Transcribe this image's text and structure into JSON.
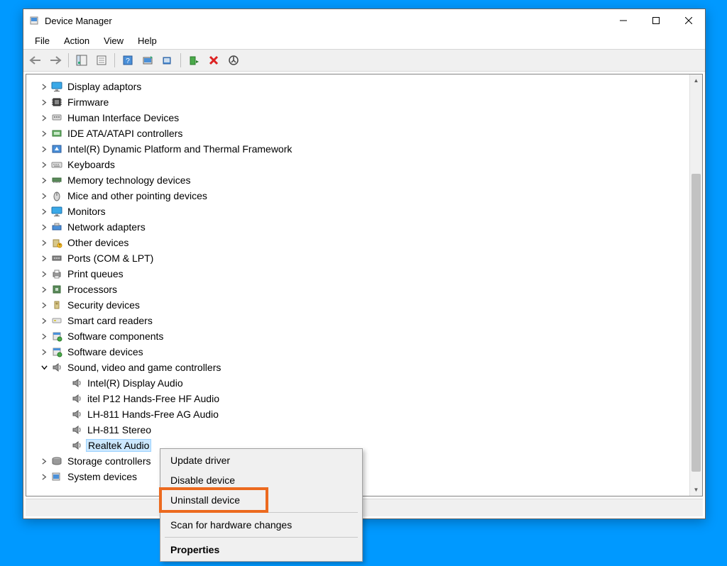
{
  "window": {
    "title": "Device Manager"
  },
  "menubar": {
    "file": "File",
    "action": "Action",
    "view": "View",
    "help": "Help"
  },
  "tree": {
    "items": [
      {
        "label": "Display adaptors",
        "icon": "monitor",
        "expanded": false,
        "level": 1
      },
      {
        "label": "Firmware",
        "icon": "chip",
        "expanded": false,
        "level": 1
      },
      {
        "label": "Human Interface Devices",
        "icon": "hid",
        "expanded": false,
        "level": 1
      },
      {
        "label": "IDE ATA/ATAPI controllers",
        "icon": "ide",
        "expanded": false,
        "level": 1
      },
      {
        "label": "Intel(R) Dynamic Platform and Thermal Framework",
        "icon": "thermal",
        "expanded": false,
        "level": 1
      },
      {
        "label": "Keyboards",
        "icon": "keyboard",
        "expanded": false,
        "level": 1
      },
      {
        "label": "Memory technology devices",
        "icon": "memory",
        "expanded": false,
        "level": 1
      },
      {
        "label": "Mice and other pointing devices",
        "icon": "mouse",
        "expanded": false,
        "level": 1
      },
      {
        "label": "Monitors",
        "icon": "monitor",
        "expanded": false,
        "level": 1
      },
      {
        "label": "Network adapters",
        "icon": "network",
        "expanded": false,
        "level": 1
      },
      {
        "label": "Other devices",
        "icon": "other",
        "expanded": false,
        "level": 1
      },
      {
        "label": "Ports (COM & LPT)",
        "icon": "port",
        "expanded": false,
        "level": 1
      },
      {
        "label": "Print queues",
        "icon": "printer",
        "expanded": false,
        "level": 1
      },
      {
        "label": "Processors",
        "icon": "cpu",
        "expanded": false,
        "level": 1
      },
      {
        "label": "Security devices",
        "icon": "security",
        "expanded": false,
        "level": 1
      },
      {
        "label": "Smart card readers",
        "icon": "smartcard",
        "expanded": false,
        "level": 1
      },
      {
        "label": "Software components",
        "icon": "software",
        "expanded": false,
        "level": 1
      },
      {
        "label": "Software devices",
        "icon": "software",
        "expanded": false,
        "level": 1
      },
      {
        "label": "Sound, video and game controllers",
        "icon": "speaker",
        "expanded": true,
        "level": 1
      },
      {
        "label": "Intel(R) Display Audio",
        "icon": "speaker",
        "child": true,
        "level": 2
      },
      {
        "label": "itel P12 Hands-Free HF Audio",
        "icon": "speaker",
        "child": true,
        "level": 2
      },
      {
        "label": "LH-811 Hands-Free AG Audio",
        "icon": "speaker",
        "child": true,
        "level": 2
      },
      {
        "label": "LH-811 Stereo",
        "icon": "speaker",
        "child": true,
        "level": 2
      },
      {
        "label": "Realtek Audio",
        "icon": "speaker",
        "child": true,
        "level": 2,
        "selected": true
      },
      {
        "label": "Storage controllers",
        "icon": "storage",
        "expanded": false,
        "level": 1
      },
      {
        "label": "System devices",
        "icon": "system",
        "expanded": false,
        "level": 1
      }
    ]
  },
  "context_menu": {
    "items": [
      {
        "label": "Update driver",
        "type": "item"
      },
      {
        "label": "Disable device",
        "type": "item"
      },
      {
        "label": "Uninstall device",
        "type": "item",
        "highlighted": true
      },
      {
        "type": "sep"
      },
      {
        "label": "Scan for hardware changes",
        "type": "item"
      },
      {
        "type": "sep"
      },
      {
        "label": "Properties",
        "type": "item",
        "bold": true
      }
    ]
  },
  "colors": {
    "desktop": "#0099ff",
    "highlight": "#ec6a1f",
    "selection": "#cce8ff"
  }
}
